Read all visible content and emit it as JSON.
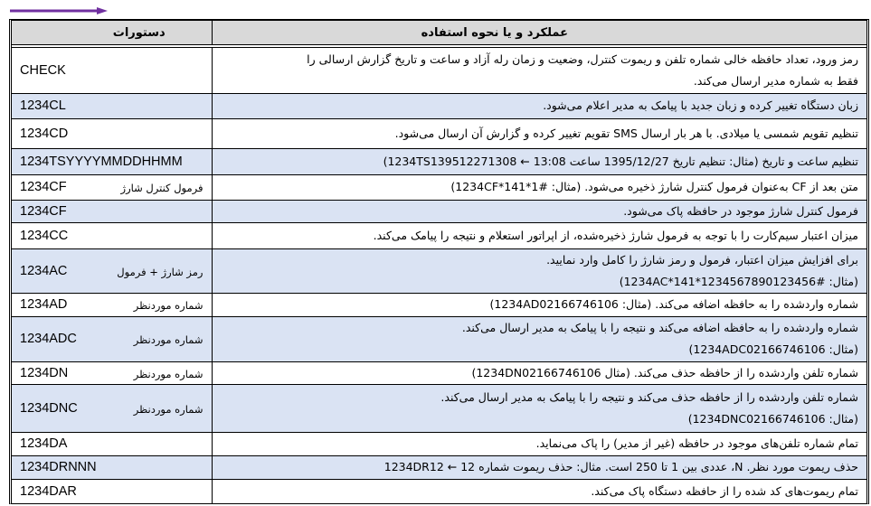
{
  "header": {
    "commands_label": "دستورات",
    "description_label": "عملکرد و یا نحوه استفاده"
  },
  "colors": {
    "arrow": "#7030a0",
    "header_bg": "#d9d9d9",
    "row_blue": "#dae3f3",
    "row_white": "#ffffff"
  },
  "rows": [
    {
      "cmd": "CHECK",
      "cmd_fa": "",
      "shade": "white",
      "lines": [
        "رمز ورود، تعداد حافظه خالی شماره تلفن و ریموت کنترل، وضعیت و زمان رله آزاد و ساعت و تاریخ گزارش ارسالی را",
        "فقط به شماره مدیر ارسال می‌کند."
      ]
    },
    {
      "cmd": "1234CL",
      "cmd_fa": "",
      "shade": "blue",
      "lines": [
        "زبان دستگاه تغییر کرده و زبان جدید با پیامک به مدیر اعلام می‌شود."
      ]
    },
    {
      "cmd": "1234CD",
      "cmd_fa": "",
      "shade": "white",
      "lines": [
        "تنظیم تقویم شمسی یا میلادی. با هر بار ارسال SMS تقویم تغییر کرده و گزارش آن ارسال می‌شود."
      ]
    },
    {
      "cmd": "1234TSYYYYMMDDHHMM",
      "cmd_fa": "",
      "shade": "blue",
      "lines": [
        "تنظیم ساعت و تاریخ (مثال: تنظیم تاریخ 1395/12/27 ساعت 13:08 ← 1234TS139512271308)"
      ]
    },
    {
      "cmd": "1234CF",
      "cmd_fa": "فرمول کنترل شارژ",
      "shade": "white",
      "lines": [
        "متن بعد از CF به‌عنوان فرمول کنترل شارژ ذخیره می‌شود. (مثال: #1*141*1234CF)"
      ]
    },
    {
      "cmd": "1234CF",
      "cmd_fa": "",
      "shade": "blue",
      "lines": [
        "فرمول کنترل شارژ موجود در حافظه پاک می‌شود."
      ]
    },
    {
      "cmd": "1234CC",
      "cmd_fa": "",
      "shade": "white",
      "lines": [
        "میزان اعتبار سیم‌کارت را با توجه به فرمول شارژ ذخیره‌شده، از اپراتور استعلام و نتیجه را پیامک می‌کند."
      ]
    },
    {
      "cmd": "1234AC",
      "cmd_fa": "رمز شارژ + فرمول",
      "shade": "blue",
      "lines": [
        "برای افزایش میزان اعتبار، فرمول و رمز شارژ را کامل وارد نمایید.",
        "(مثال: #1234AC*141*1234567890123456)"
      ]
    },
    {
      "cmd": "1234AD",
      "cmd_fa": "شماره موردنظر",
      "shade": "white",
      "lines": [
        "شماره واردشده را به حافظه اضافه می‌کند. (مثال: 1234AD02166746106)"
      ]
    },
    {
      "cmd": "1234ADC",
      "cmd_fa": "شماره موردنظر",
      "shade": "blue",
      "lines": [
        "شماره واردشده را به حافظه اضافه می‌کند و نتیجه را با پیامک به مدیر ارسال می‌کند.",
        "(مثال: 1234ADC02166746106)"
      ]
    },
    {
      "cmd": "1234DN",
      "cmd_fa": "شماره موردنظر",
      "shade": "white",
      "lines": [
        "شماره تلفن واردشده را از حافظه حذف می‌کند. (مثال 1234DN02166746106)"
      ]
    },
    {
      "cmd": "1234DNC",
      "cmd_fa": "شماره موردنظر",
      "shade": "blue",
      "lines": [
        "شماره تلفن واردشده را از حافظه حذف می‌کند و نتیجه را با پیامک به مدیر ارسال می‌کند.",
        "(مثال: 1234DNC02166746106)"
      ]
    },
    {
      "cmd": "1234DA",
      "cmd_fa": "",
      "shade": "white",
      "lines": [
        "تمام شماره تلفن‌های موجود در حافظه (غیر از مدیر) را پاک می‌نماید."
      ]
    },
    {
      "cmd": "1234DRNNN",
      "cmd_fa": "",
      "shade": "blue",
      "lines": [
        "حذف ریموت مورد نظر. N، عددی بین 1 تا 250 است. مثال: حذف ریموت شماره 12 ← 1234DR12"
      ]
    },
    {
      "cmd": "1234DAR",
      "cmd_fa": "",
      "shade": "white",
      "lines": [
        "تمام ریموت‌های کد شده را از حافظه دستگاه پاک می‌کند."
      ]
    }
  ]
}
